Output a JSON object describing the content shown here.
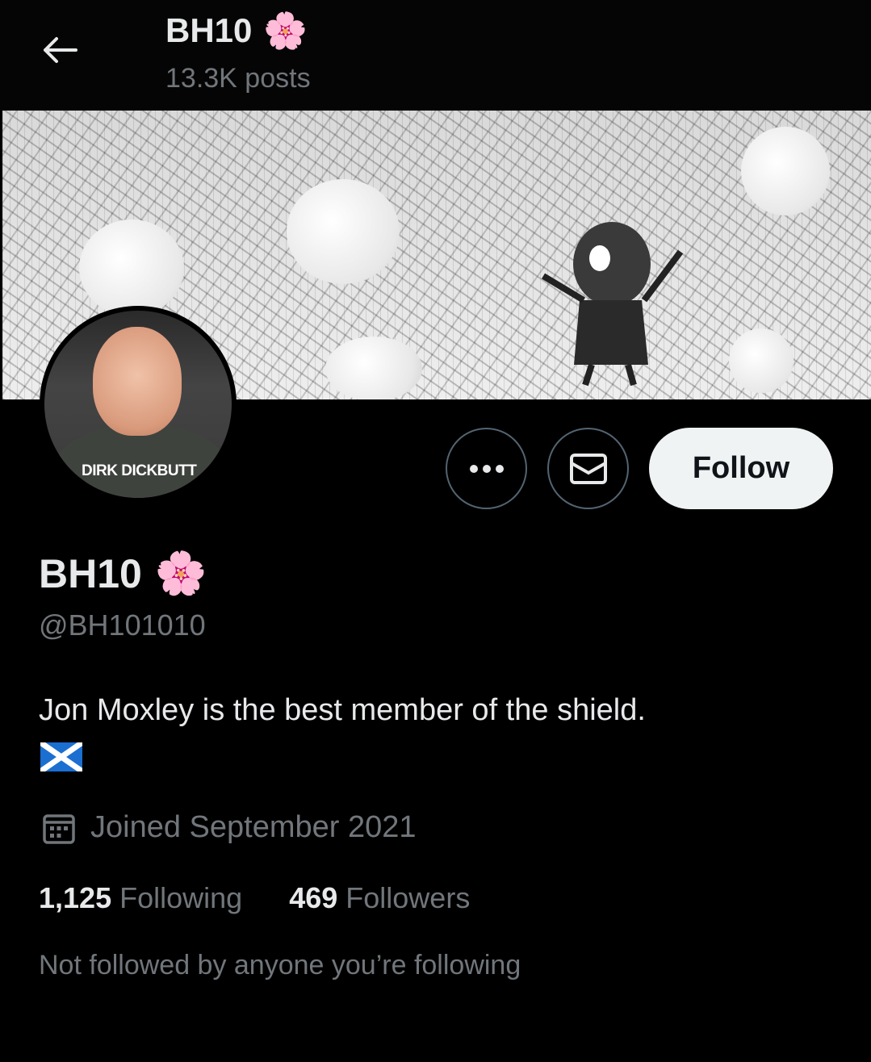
{
  "header": {
    "title": "BH10",
    "title_emoji": "🌸",
    "posts": "13.3K posts",
    "back_icon": "arrow-left-icon"
  },
  "banner": {
    "alt": "manga city banner"
  },
  "avatar": {
    "caption": "DIRK DICKBUTT"
  },
  "actions": {
    "more_icon": "more-icon",
    "message_icon": "mail-icon",
    "follow_label": "Follow"
  },
  "profile": {
    "display_name": "BH10",
    "name_emoji": "🌸",
    "handle": "@BH101010",
    "bio": "Jon Moxley is the best member of the shield.",
    "joined": "Joined September 2021",
    "following_count": "1,125",
    "following_label": "Following",
    "followers_count": "469",
    "followers_label": "Followers",
    "mutuals_note": "Not followed by anyone you’re following"
  },
  "colors": {
    "background": "#000000",
    "text_primary": "#e7e9ea",
    "text_secondary": "#71767b",
    "button_border": "#536471",
    "follow_bg": "#eff3f4"
  }
}
